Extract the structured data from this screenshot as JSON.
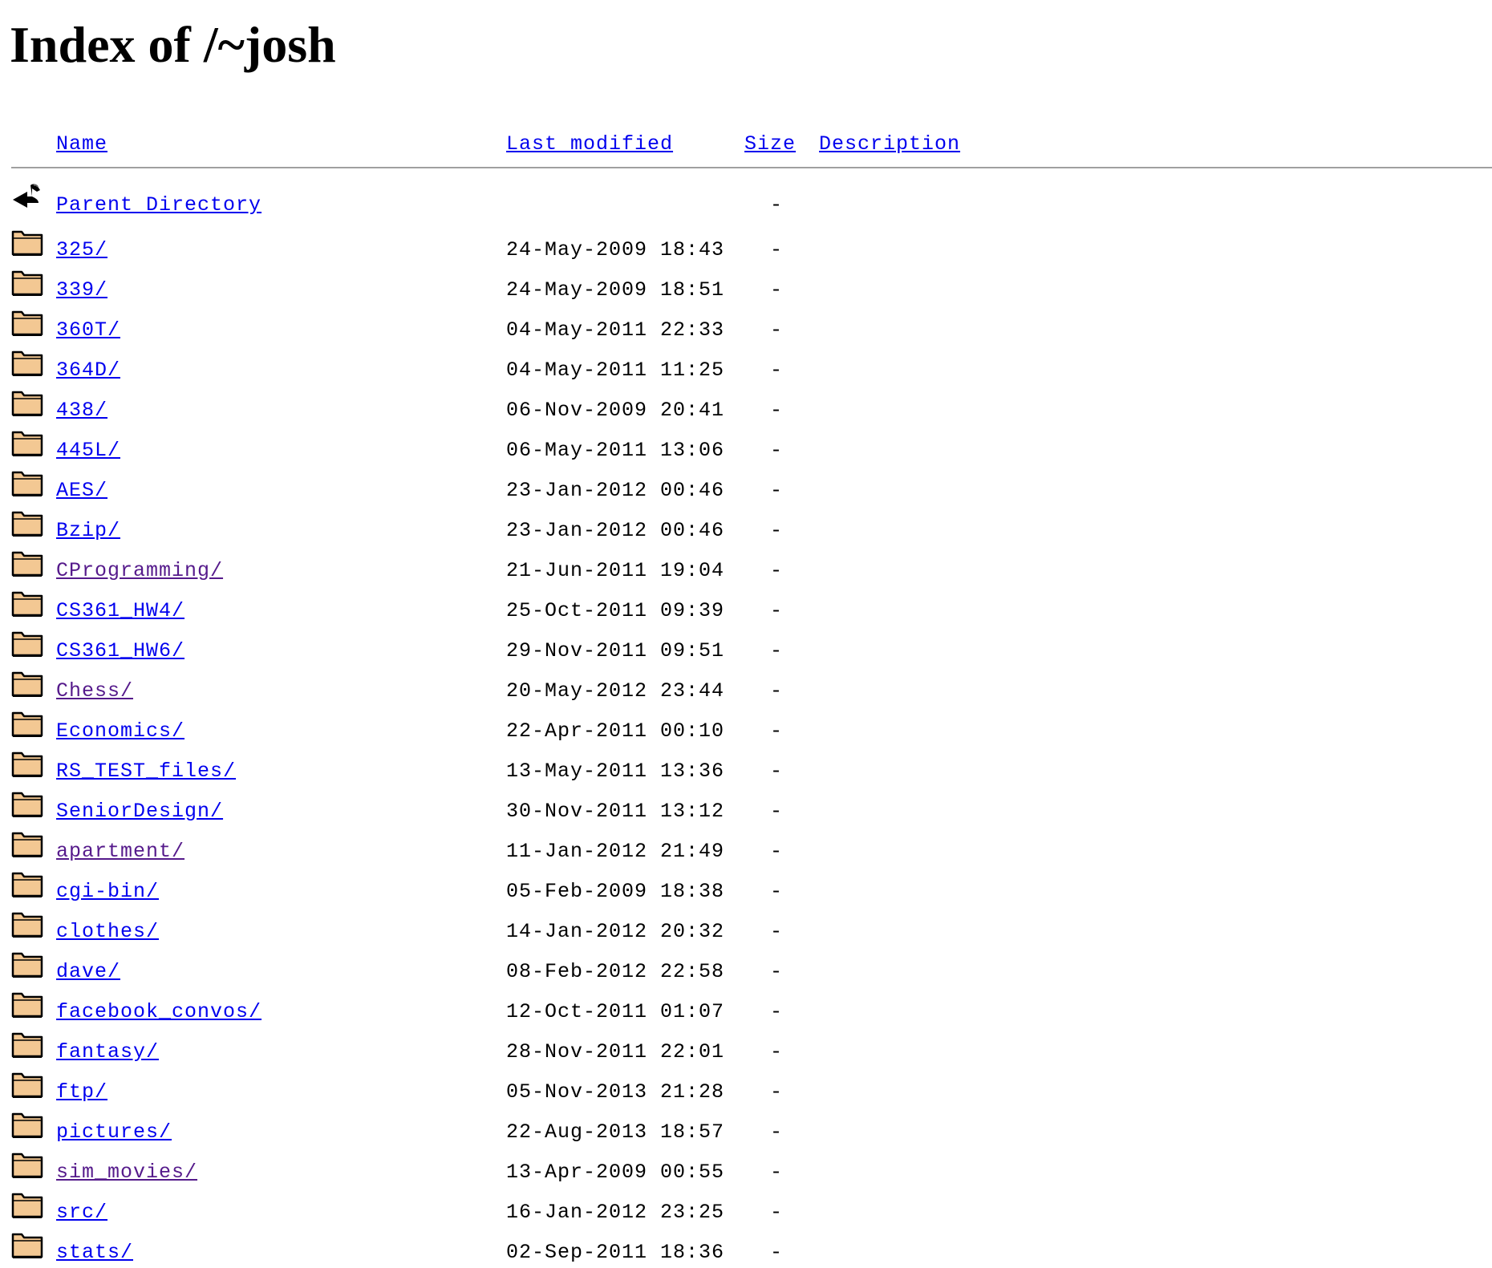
{
  "page": {
    "title": "Index of /~josh"
  },
  "columns": {
    "name": "Name",
    "last_modified": "Last modified",
    "size": "Size",
    "description": "Description"
  },
  "parent": {
    "label": "Parent Directory",
    "size": "-",
    "icon": "back-arrow-icon"
  },
  "entries": [
    {
      "name": "325/",
      "date": "24-May-2009 18:43",
      "size": "-",
      "visited": false
    },
    {
      "name": "339/",
      "date": "24-May-2009 18:51",
      "size": "-",
      "visited": false
    },
    {
      "name": "360T/",
      "date": "04-May-2011 22:33",
      "size": "-",
      "visited": false
    },
    {
      "name": "364D/",
      "date": "04-May-2011 11:25",
      "size": "-",
      "visited": false
    },
    {
      "name": "438/",
      "date": "06-Nov-2009 20:41",
      "size": "-",
      "visited": false
    },
    {
      "name": "445L/",
      "date": "06-May-2011 13:06",
      "size": "-",
      "visited": false
    },
    {
      "name": "AES/",
      "date": "23-Jan-2012 00:46",
      "size": "-",
      "visited": false
    },
    {
      "name": "Bzip/",
      "date": "23-Jan-2012 00:46",
      "size": "-",
      "visited": false
    },
    {
      "name": "CProgramming/",
      "date": "21-Jun-2011 19:04",
      "size": "-",
      "visited": true
    },
    {
      "name": "CS361_HW4/",
      "date": "25-Oct-2011 09:39",
      "size": "-",
      "visited": false
    },
    {
      "name": "CS361_HW6/",
      "date": "29-Nov-2011 09:51",
      "size": "-",
      "visited": false
    },
    {
      "name": "Chess/",
      "date": "20-May-2012 23:44",
      "size": "-",
      "visited": true
    },
    {
      "name": "Economics/",
      "date": "22-Apr-2011 00:10",
      "size": "-",
      "visited": false
    },
    {
      "name": "RS_TEST_files/",
      "date": "13-May-2011 13:36",
      "size": "-",
      "visited": false
    },
    {
      "name": "SeniorDesign/",
      "date": "30-Nov-2011 13:12",
      "size": "-",
      "visited": false
    },
    {
      "name": "apartment/",
      "date": "11-Jan-2012 21:49",
      "size": "-",
      "visited": true
    },
    {
      "name": "cgi-bin/",
      "date": "05-Feb-2009 18:38",
      "size": "-",
      "visited": false
    },
    {
      "name": "clothes/",
      "date": "14-Jan-2012 20:32",
      "size": "-",
      "visited": false
    },
    {
      "name": "dave/",
      "date": "08-Feb-2012 22:58",
      "size": "-",
      "visited": false
    },
    {
      "name": "facebook_convos/",
      "date": "12-Oct-2011 01:07",
      "size": "-",
      "visited": false
    },
    {
      "name": "fantasy/",
      "date": "28-Nov-2011 22:01",
      "size": "-",
      "visited": false
    },
    {
      "name": "ftp/",
      "date": "05-Nov-2013 21:28",
      "size": "-",
      "visited": false
    },
    {
      "name": "pictures/",
      "date": "22-Aug-2013 18:57",
      "size": "-",
      "visited": false
    },
    {
      "name": "sim_movies/",
      "date": "13-Apr-2009 00:55",
      "size": "-",
      "visited": true
    },
    {
      "name": "src/",
      "date": "16-Jan-2012 23:25",
      "size": "-",
      "visited": false
    },
    {
      "name": "stats/",
      "date": "02-Sep-2011 18:36",
      "size": "-",
      "visited": false
    }
  ],
  "icons": {
    "folder": "folder-icon"
  },
  "colors": {
    "link": "#0000ee",
    "visited": "#551a8b",
    "folder_fill": "#f3c893",
    "rule": "#a0a0a0"
  }
}
